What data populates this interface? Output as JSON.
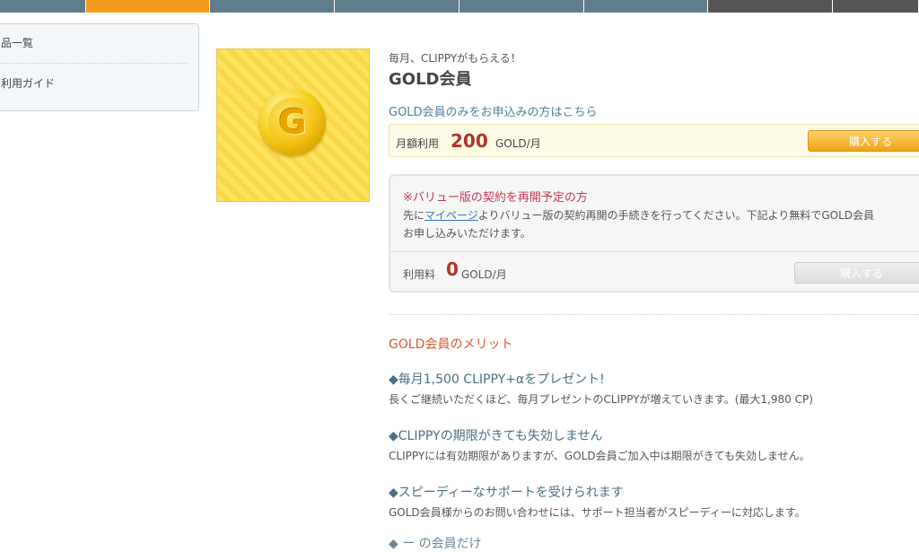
{
  "nav": {
    "tabs": [
      "",
      "",
      "",
      "",
      "",
      "",
      "",
      ""
    ],
    "active_index": 1
  },
  "sidebar": {
    "items": [
      {
        "label": "品一覧"
      },
      {
        "label": "利用ガイド"
      }
    ]
  },
  "product": {
    "tagline": "毎月、CLIPPYがもらえる！",
    "title": "GOLD会員",
    "image_icon": "gold-coin-icon",
    "image_letter": "G"
  },
  "gold_only": {
    "heading": "GOLD会員のみをお申込みの方はこちら",
    "label": "月額利用",
    "amount": "200",
    "unit": "GOLD/月",
    "button": "購入する"
  },
  "value_plan": {
    "heading": "※バリュー版の契約を再開予定の方",
    "text_before": "先に",
    "link": "マイページ",
    "text_after": "よりバリュー版の契約再開の手続きを行ってください。下記より無料でGOLD会員",
    "text_line2": "お申し込みいただけます。",
    "label": "利用料",
    "amount": "0",
    "unit": "GOLD/月",
    "button": "購入する"
  },
  "merits": {
    "heading": "GOLD会員のメリット",
    "items": [
      {
        "title": "◆毎月1,500 CLIPPY+αをプレゼント!",
        "desc": "長くご継続いただくほど、毎月プレゼントのCLIPPYが増えていきます。(最大1,980 CP)"
      },
      {
        "title": "◆CLIPPYの期限がきても失効しません",
        "desc": "CLIPPYには有効期限がありますが、GOLD会員ご加入中は期限がきても失効しません。"
      },
      {
        "title": "◆スピーディーなサポートを受けられます",
        "desc": "GOLD会員様からのお問い合わせには、サポート担当者がスピーディーに対応します。"
      }
    ],
    "cutoff_text": "◆ ー の会員だけ"
  },
  "colors": {
    "accent": "#f39a1e",
    "price": "#b0342a",
    "link": "#3b75b2"
  }
}
